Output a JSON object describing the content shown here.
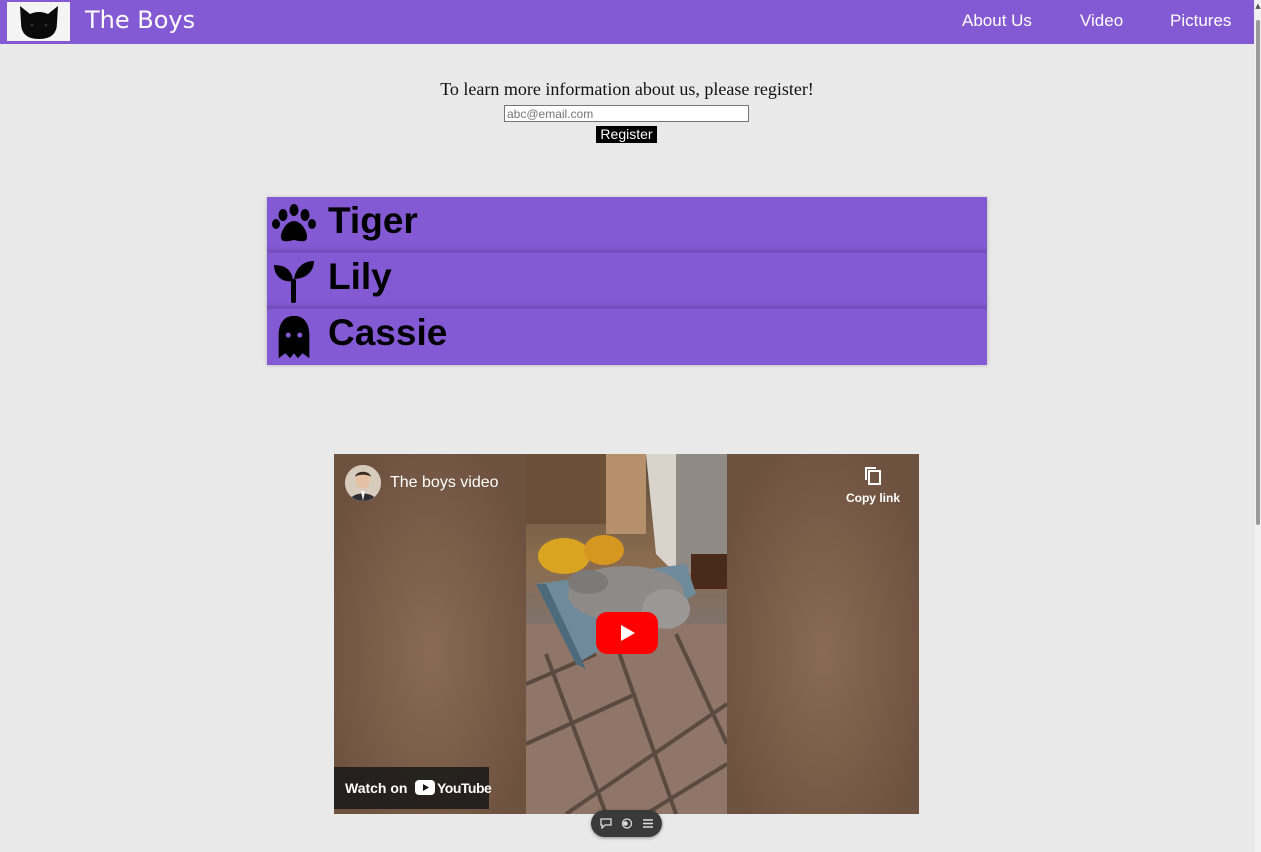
{
  "navbar": {
    "brand": "The Boys",
    "links": [
      "About Us",
      "Video",
      "Pictures"
    ]
  },
  "register": {
    "prompt": "To learn more information about us, please register!",
    "email_placeholder": "abc@email.com",
    "button_label": "Register"
  },
  "cats": [
    {
      "name": "Tiger",
      "icon": "paw-icon"
    },
    {
      "name": "Lily",
      "icon": "sprout-icon"
    },
    {
      "name": "Cassie",
      "icon": "ghost-icon"
    }
  ],
  "video": {
    "title": "The boys video",
    "copy_link_label": "Copy link",
    "watch_on_label": "Watch on",
    "youtube_label": "YouTube"
  },
  "colors": {
    "accent": "#845ad4",
    "background": "#e9e9e9",
    "youtube_red": "#ff0000"
  }
}
